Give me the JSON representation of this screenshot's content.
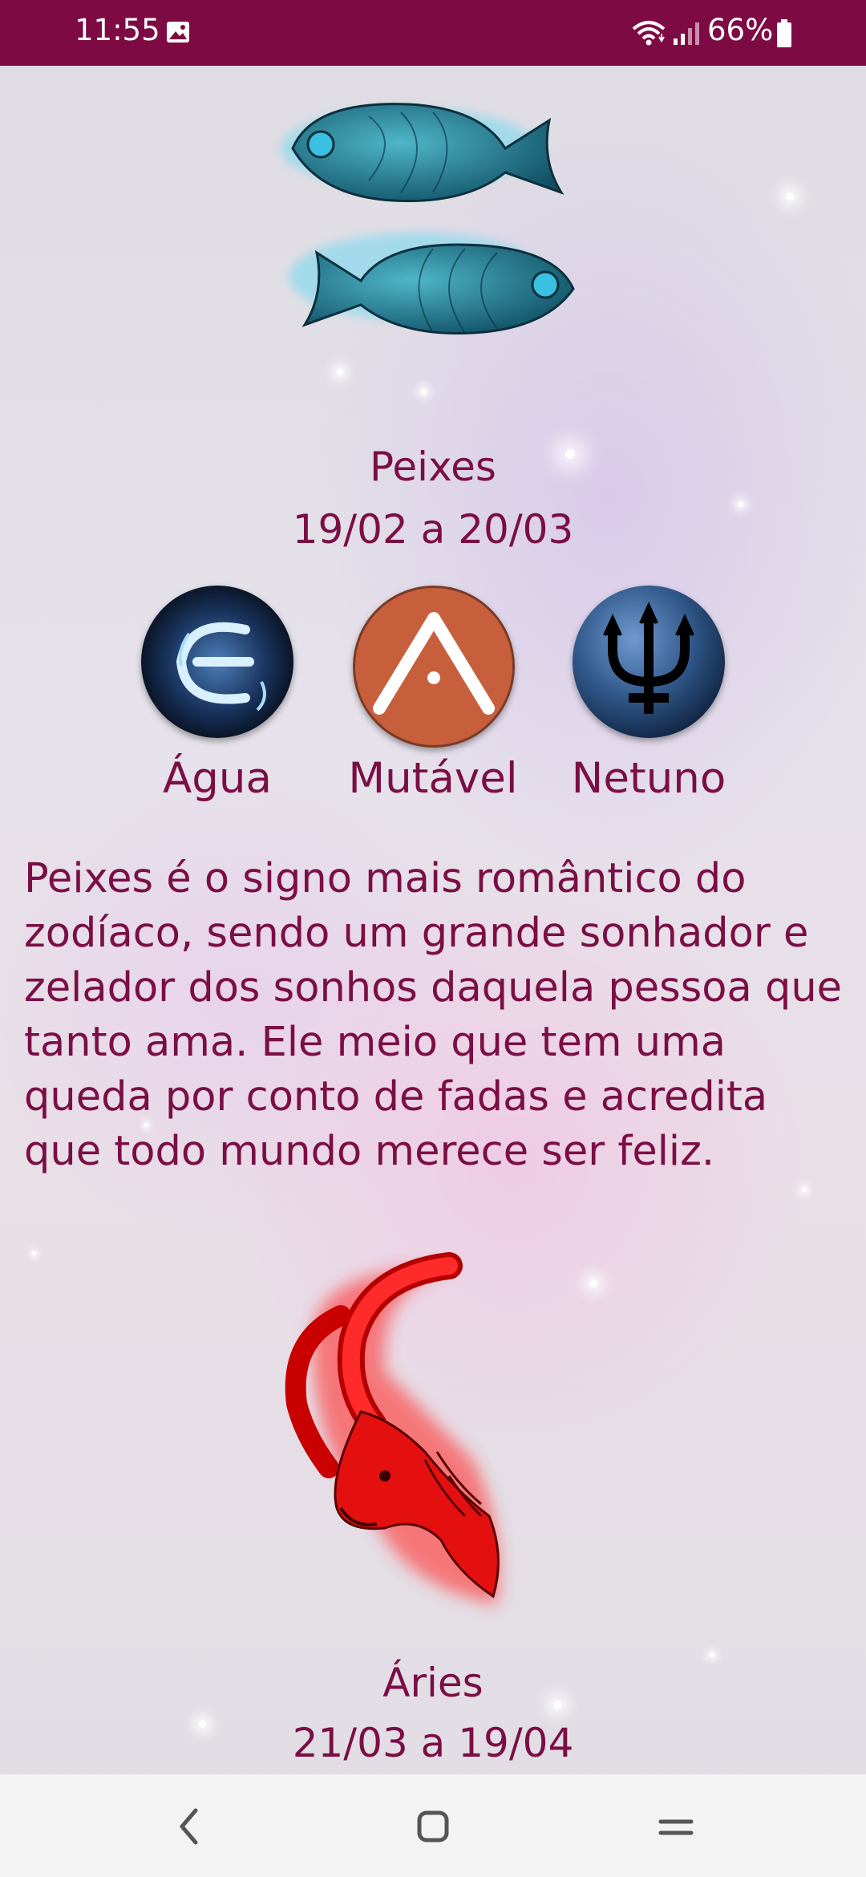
{
  "status_bar": {
    "time": "11:55",
    "battery": "66%",
    "background": "#7e0a43",
    "icons": [
      "gallery-icon",
      "wifi-icon",
      "signal-icon",
      "battery-icon"
    ]
  },
  "signs": [
    {
      "name": "Peixes",
      "dates": "19/02 a 20/03",
      "figure": "pisces-fish-icon",
      "traits": [
        {
          "label": "Água",
          "icon": "water-element-icon"
        },
        {
          "label": "Mutável",
          "icon": "mutable-modality-icon"
        },
        {
          "label": "Netuno",
          "icon": "neptune-planet-icon"
        }
      ],
      "description": "Peixes é o signo mais romântico do zodíaco, sendo um grande sonhador e zelador dos sonhos daquela pessoa que tanto ama. Ele meio que tem uma queda por conto de fadas e acredita que todo mundo merece ser feliz."
    },
    {
      "name": "Áries",
      "dates": "21/03 a 19/04",
      "figure": "aries-ram-icon"
    }
  ],
  "nav_bar": {
    "buttons": [
      "back-icon",
      "home-icon",
      "recents-icon"
    ]
  },
  "colors": {
    "text": "#7a0e45",
    "accent": "#7e0a43"
  }
}
